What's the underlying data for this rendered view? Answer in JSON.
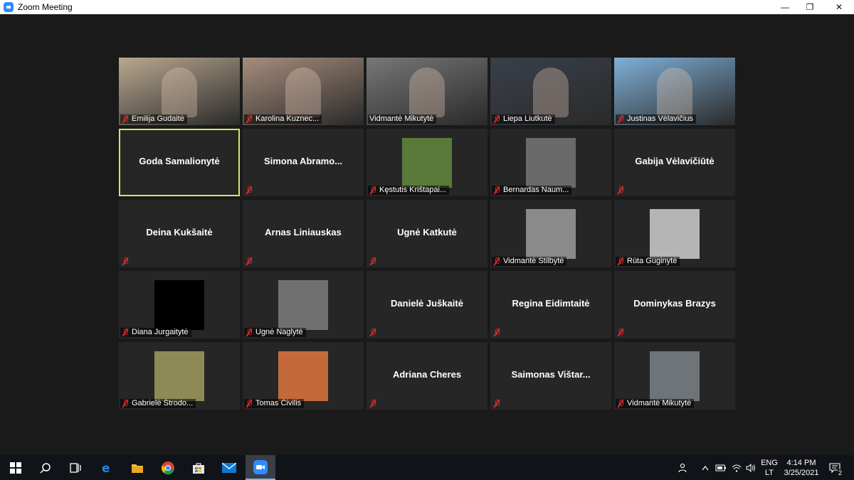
{
  "window": {
    "title": "Zoom Meeting",
    "minimize": "—",
    "restore": "❐",
    "close": "✕"
  },
  "participants": [
    {
      "name": "Emilija Gudaitė",
      "video": true,
      "muted": true,
      "bg": "#b9a88f"
    },
    {
      "name": "Karolina Kuznec...",
      "video": true,
      "muted": true,
      "bg": "#a68d7c"
    },
    {
      "name": "Vidmantė Mikutytė",
      "video": true,
      "muted": false,
      "bg": "#777777"
    },
    {
      "name": "Liepa Liutkutė",
      "video": true,
      "muted": true,
      "bg": "#3a3f4a"
    },
    {
      "name": "Justinas Vėlavičius",
      "video": true,
      "muted": true,
      "bg": "#7fb0d8"
    },
    {
      "name": "Goda Samalionytė",
      "video": false,
      "active": true,
      "muted": false
    },
    {
      "name": "Simona  Abramo...",
      "video": false,
      "muted": true
    },
    {
      "name": "Kęstutis Krištapai...",
      "video": false,
      "thumb": true,
      "thumb_bg": "#5a7a3a",
      "muted": true
    },
    {
      "name": "Bernardas Naum...",
      "video": false,
      "thumb": true,
      "thumb_bg": "#6a6a6a",
      "muted": true
    },
    {
      "name": "Gabija Vėlavičiūtė",
      "video": false,
      "muted": true
    },
    {
      "name": "Deina Kukšaitė",
      "video": false,
      "muted": true
    },
    {
      "name": "Arnas Liniauskas",
      "video": false,
      "muted": true
    },
    {
      "name": "Ugnė Katkutė",
      "video": false,
      "muted": true
    },
    {
      "name": "Vidmantė Stilbytė",
      "video": false,
      "thumb": true,
      "thumb_bg": "#8a8a8a",
      "muted": true
    },
    {
      "name": "Rūta Guginytė",
      "video": false,
      "thumb": true,
      "thumb_bg": "#b5b5b5",
      "muted": true
    },
    {
      "name": "Diana Jurgaitytė",
      "video": false,
      "thumb": true,
      "thumb_bg": "#000000",
      "muted": true
    },
    {
      "name": "Ugnė Naglytė",
      "video": false,
      "thumb": true,
      "thumb_bg": "#707070",
      "muted": true
    },
    {
      "name": "Danielė Juškaitė",
      "video": false,
      "muted": true
    },
    {
      "name": "Regina Eidimtaitė",
      "video": false,
      "muted": true
    },
    {
      "name": "Dominykas Brazys",
      "video": false,
      "muted": true
    },
    {
      "name": "Gabrielė Štrodo...",
      "video": false,
      "thumb": true,
      "thumb_bg": "#8d8a55",
      "muted": true
    },
    {
      "name": "Tomas Čivilis",
      "video": false,
      "thumb": true,
      "thumb_bg": "#c46a3a",
      "muted": true
    },
    {
      "name": "Adriana Cheres",
      "video": false,
      "muted": true
    },
    {
      "name": "Saimonas  Vištar...",
      "video": false,
      "muted": true
    },
    {
      "name": "Vidmantė Mikutytė",
      "video": false,
      "thumb": true,
      "thumb_bg": "#6e7478",
      "muted": true
    }
  ],
  "taskbar": {
    "icons": [
      "windows-start-icon",
      "search-icon",
      "task-view-icon",
      "edge-browser-icon",
      "file-explorer-icon",
      "chrome-icon",
      "store-icon",
      "mail-icon",
      "zoom-icon"
    ],
    "language": "ENG",
    "region": "LT",
    "time": "4:14 PM",
    "date": "3/25/2021",
    "notifications": "2"
  }
}
